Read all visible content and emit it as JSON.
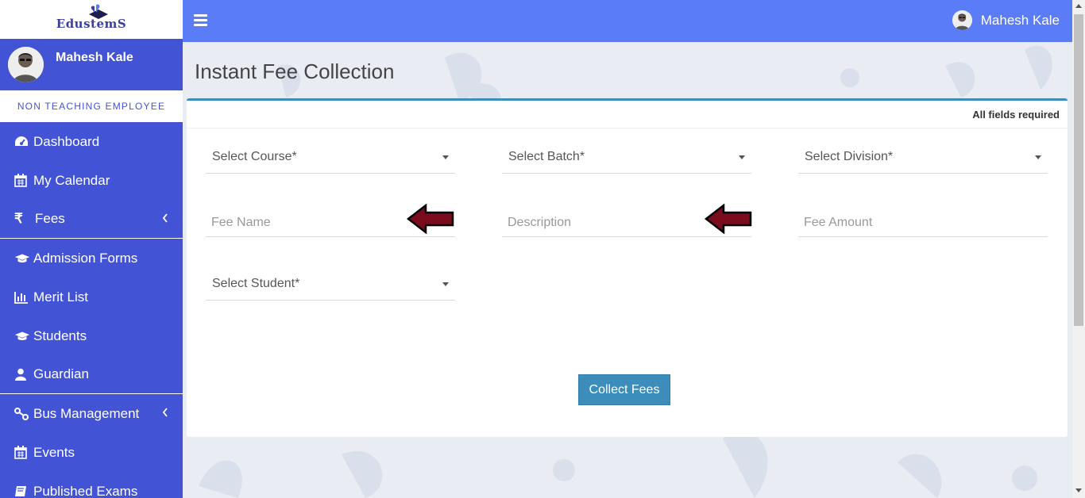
{
  "brand": {
    "name": "EdustemS",
    "logo_icon": "graduation-cap-sprout-logo"
  },
  "colors": {
    "sidebar": "#4353d6",
    "topbar": "#5b7cf7",
    "accent": "#3c8dbc",
    "arrow": "#7a0c1e"
  },
  "user": {
    "name": "Mahesh Kale",
    "role": "NON TEACHING EMPLOYEE"
  },
  "sidebar": {
    "items": [
      {
        "label": "Dashboard",
        "icon": "dashboard-icon"
      },
      {
        "label": "My Calendar",
        "icon": "calendar-icon"
      },
      {
        "label": "Fees",
        "icon": "rupee-icon",
        "symbol": "₹",
        "has_submenu": true
      },
      {
        "label": "Admission Forms",
        "icon": "graduation-cap-icon"
      },
      {
        "label": "Merit List",
        "icon": "bar-chart-icon"
      },
      {
        "label": "Students",
        "icon": "graduation-cap-icon"
      },
      {
        "label": "Guardian",
        "icon": "user-icon"
      },
      {
        "label": "Bus Management",
        "icon": "route-icon",
        "has_submenu": true
      },
      {
        "label": "Events",
        "icon": "calendar-icon"
      },
      {
        "label": "Published Exams",
        "icon": "book-icon"
      }
    ]
  },
  "topbar": {
    "menu_icon": "hamburger-icon",
    "user_name": "Mahesh Kale"
  },
  "page": {
    "title": "Instant Fee Collection",
    "card_note": "All fields required",
    "fields": {
      "course": "Select Course*",
      "batch": "Select Batch*",
      "division": "Select Division*",
      "fee_name": "Fee Name",
      "description": "Description",
      "fee_amount": "Fee Amount",
      "student": "Select Student*"
    },
    "submit_label": "Collect Fees"
  }
}
